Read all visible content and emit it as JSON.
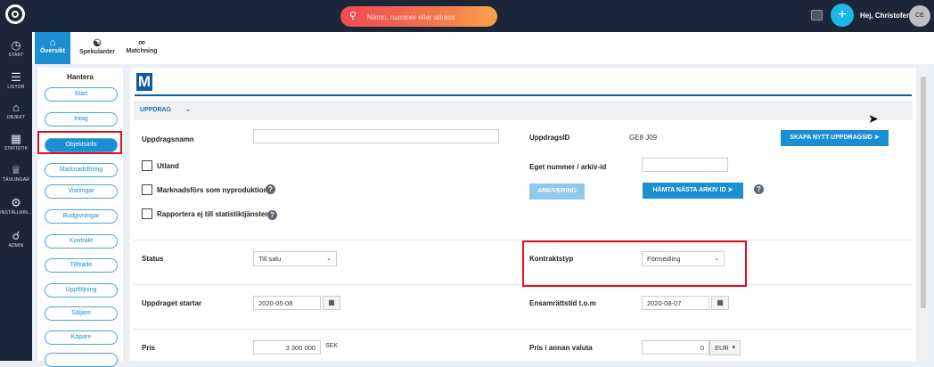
{
  "topbar": {
    "search_placeholder": "Namn, nummer eller adress",
    "greeting": "Hej, Christofer!",
    "avatar_initials": "CE",
    "add_symbol": "+"
  },
  "sidebar": {
    "items": [
      {
        "label": "START",
        "icon": "gauge-icon"
      },
      {
        "label": "LISTOR",
        "icon": "list-icon"
      },
      {
        "label": "OBJEKT",
        "icon": "house-icon"
      },
      {
        "label": "STATISTIK",
        "icon": "chart-icon"
      },
      {
        "label": "TÄVLINGAR",
        "icon": "trophy-icon"
      },
      {
        "label": "INSTÄLLNIN...",
        "icon": "gear-icon"
      },
      {
        "label": "ADMIN",
        "icon": "lock-icon"
      }
    ]
  },
  "subtabs": [
    {
      "label": "Översikt",
      "icon": "house-icon"
    },
    {
      "label": "Spekulanter",
      "icon": "people-icon"
    },
    {
      "label": "Matchning",
      "icon": "link-icon"
    }
  ],
  "hantera": {
    "title": "Hantera",
    "items": [
      "Start",
      "Intag",
      "Objektsinfo",
      "Marknadsföring",
      "Visningar",
      "Budgivningar",
      "Kontrakt",
      "Tillträde",
      "Uppföljning",
      "Säljare",
      "Köpare"
    ],
    "active": "Objektsinfo"
  },
  "main": {
    "brand": "M",
    "section_title": "UPPDRAG",
    "uppdragsnamn_label": "Uppdragsnamn",
    "uppdragsnamn_value": "",
    "uppdragsid_label": "UppdragsID",
    "uppdragsid_value": "GE8 J09",
    "skapa_button": "SKAPA NYTT UPPDRAGSID",
    "utland_label": "Utland",
    "eget_nummer_label": "Eget nummer / arkiv-id",
    "nyproduktion_label": "Marknadsförs som nyproduktion",
    "arkivering_button": "ARKIVERING",
    "hamta_button": "HÄMTA NÄSTA ARKIV ID",
    "rapportera_label": "Rapportera ej till statistiktjänster",
    "status_label": "Status",
    "status_value": "Till salu",
    "kontraktstyp_label": "Kontraktstyp",
    "kontraktstyp_value": "Förmedling",
    "uppdraget_startar_label": "Uppdraget startar",
    "uppdraget_startar_value": "2020-05-08",
    "ensamratt_label": "Ensamrättstid t.o.m",
    "ensamratt_value": "2020-08-07",
    "pris_label": "Pris",
    "pris_value": "3 300 000",
    "pris_currency": "SEK",
    "pris_annan_label": "Pris i annan valuta",
    "pris_annan_value": "0",
    "pris_annan_currency": "EUR"
  },
  "colors": {
    "topbar_bg": "#1b2738",
    "accent_blue": "#1b8fd1",
    "highlight_red": "#e0101f",
    "search_gradient_start": "#ef4a55",
    "search_gradient_end": "#f7a34a"
  }
}
